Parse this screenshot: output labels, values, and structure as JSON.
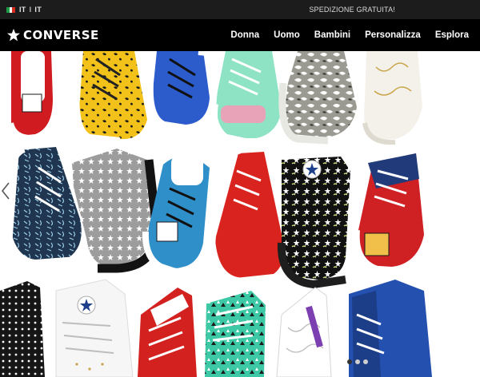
{
  "topbar": {
    "language_left": "IT",
    "language_separator": "I",
    "language_right": "IT",
    "shipping_text": "SPEDIZIONE GRATUITA!"
  },
  "header": {
    "logo_text": "CONVERSE",
    "nav": [
      {
        "label": "Donna"
      },
      {
        "label": "Uomo"
      },
      {
        "label": "Bambini"
      },
      {
        "label": "Personalizza"
      },
      {
        "label": "Esplora"
      }
    ]
  },
  "hero": {
    "image": "grid of Chuck Taylor All Star sneakers in assorted colors and prints",
    "carousel": {
      "dots": 3,
      "active_index": 0
    }
  },
  "colors": {
    "topbar_bg": "#1c1c1c",
    "nav_bg": "#000000",
    "nav_text": "#ffffff"
  }
}
